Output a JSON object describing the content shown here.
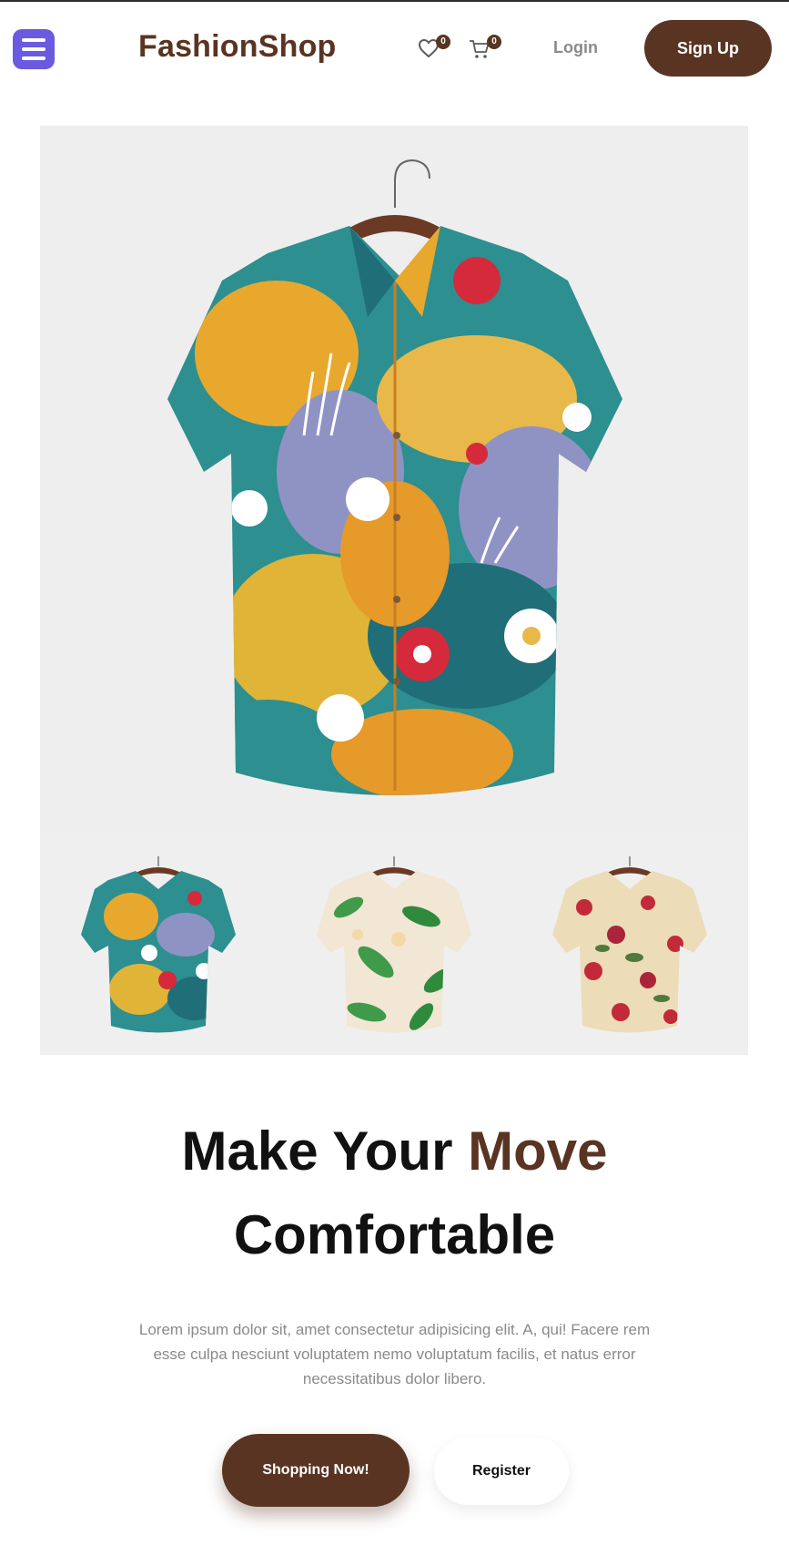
{
  "header": {
    "brand": "FashionShop",
    "wishlist_count": "0",
    "cart_count": "0",
    "login_label": "Login",
    "signup_label": "Sign Up"
  },
  "gallery": {
    "main_image": "colorful-abstract-print-shirt",
    "thumbnails": [
      "colorful-abstract-print-shirt",
      "tropical-leaf-print-shirt",
      "red-floral-print-shirt"
    ]
  },
  "hero": {
    "headline_part1": "Make Your ",
    "headline_accent": "Move",
    "headline_part2": "Comfortable",
    "description": "Lorem ipsum dolor sit, amet consectetur adipisicing elit. A, qui! Facere rem esse culpa nesciunt voluptatem nemo voluptatum facilis, et natus error necessitatibus dolor libero.",
    "shop_button": "Shopping Now!",
    "register_button": "Register"
  },
  "colors": {
    "brand": "#5a3422",
    "menu": "#6a5ae0",
    "muted_text": "#8a8a8a"
  }
}
